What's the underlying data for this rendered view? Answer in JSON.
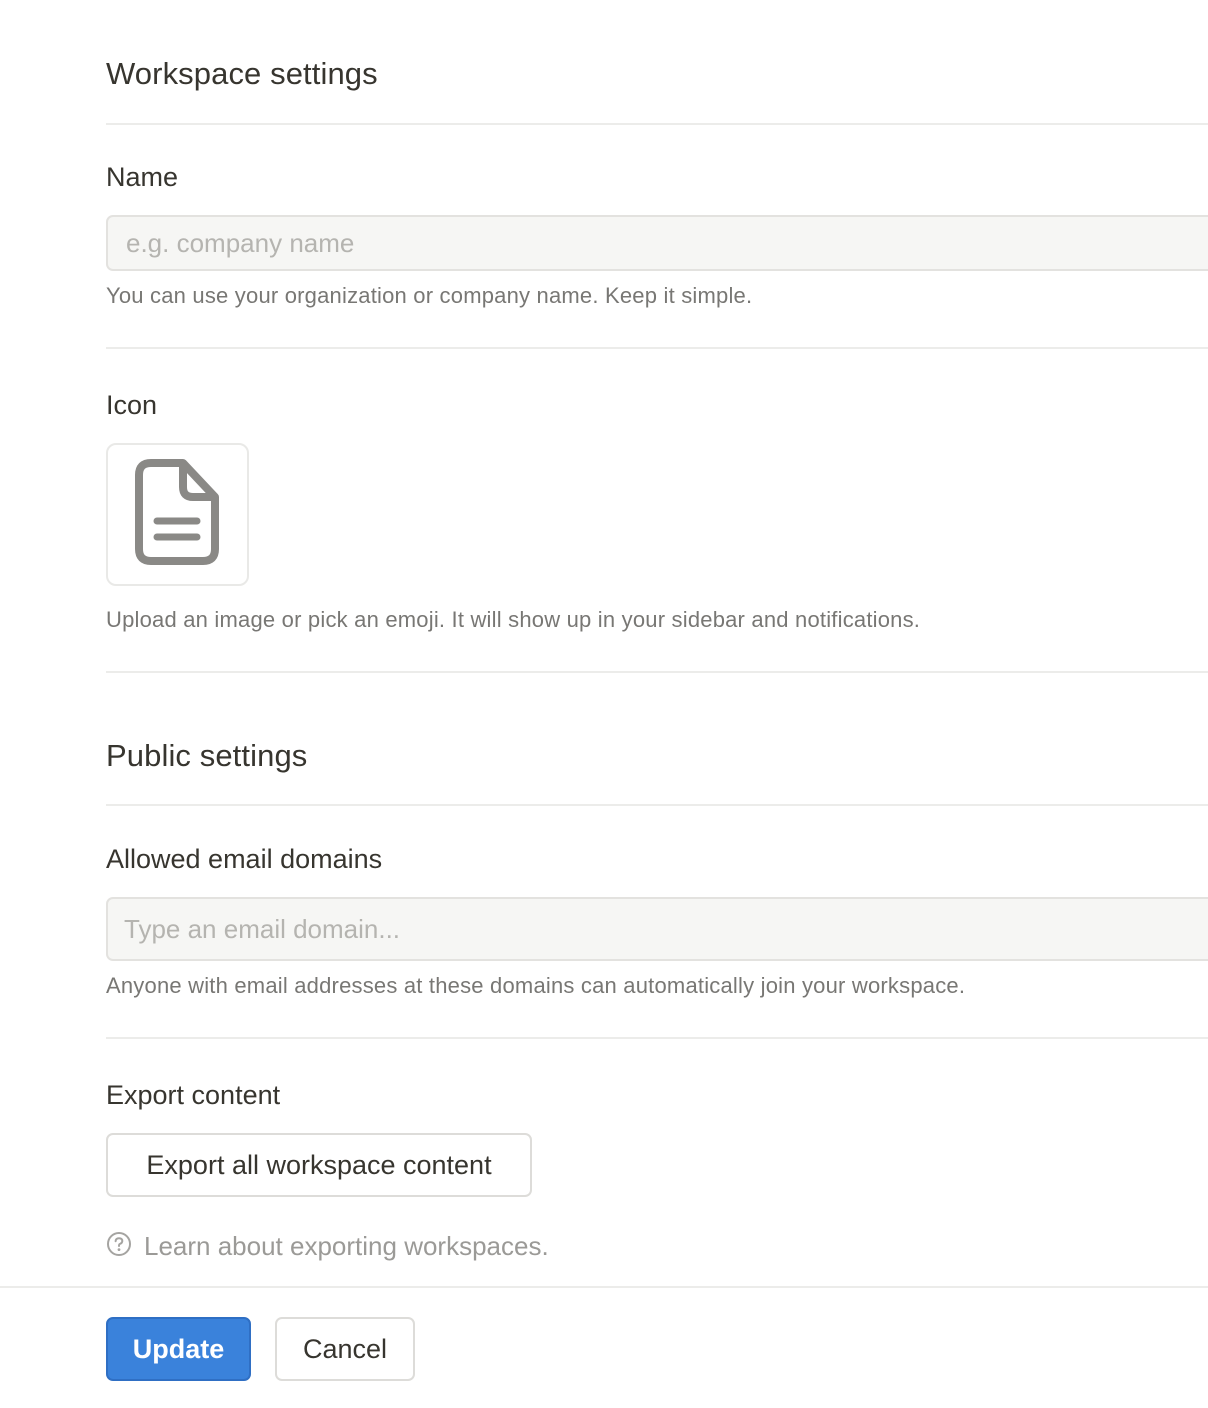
{
  "workspace_settings": {
    "title": "Workspace settings",
    "name": {
      "label": "Name",
      "value": "",
      "placeholder": "e.g. company name",
      "help": "You can use your organization or company name. Keep it simple."
    },
    "icon": {
      "label": "Icon",
      "current_icon": "document-icon",
      "help": "Upload an image or pick an emoji. It will show up in your sidebar and notifications."
    }
  },
  "public_settings": {
    "title": "Public settings",
    "allowed_email_domains": {
      "label": "Allowed email domains",
      "value": "",
      "placeholder": "Type an email domain...",
      "help": "Anyone with email addresses at these domains can automatically join your workspace."
    },
    "export_content": {
      "label": "Export content",
      "button_label": "Export all workspace content",
      "learn_icon": "question-circle-icon",
      "learn_link": "Learn about exporting workspaces."
    }
  },
  "footer": {
    "update_label": "Update",
    "cancel_label": "Cancel"
  },
  "colors": {
    "primary": "#3a82db",
    "text": "#37352f",
    "muted": "#787774",
    "input_bg": "#f6f6f4"
  }
}
